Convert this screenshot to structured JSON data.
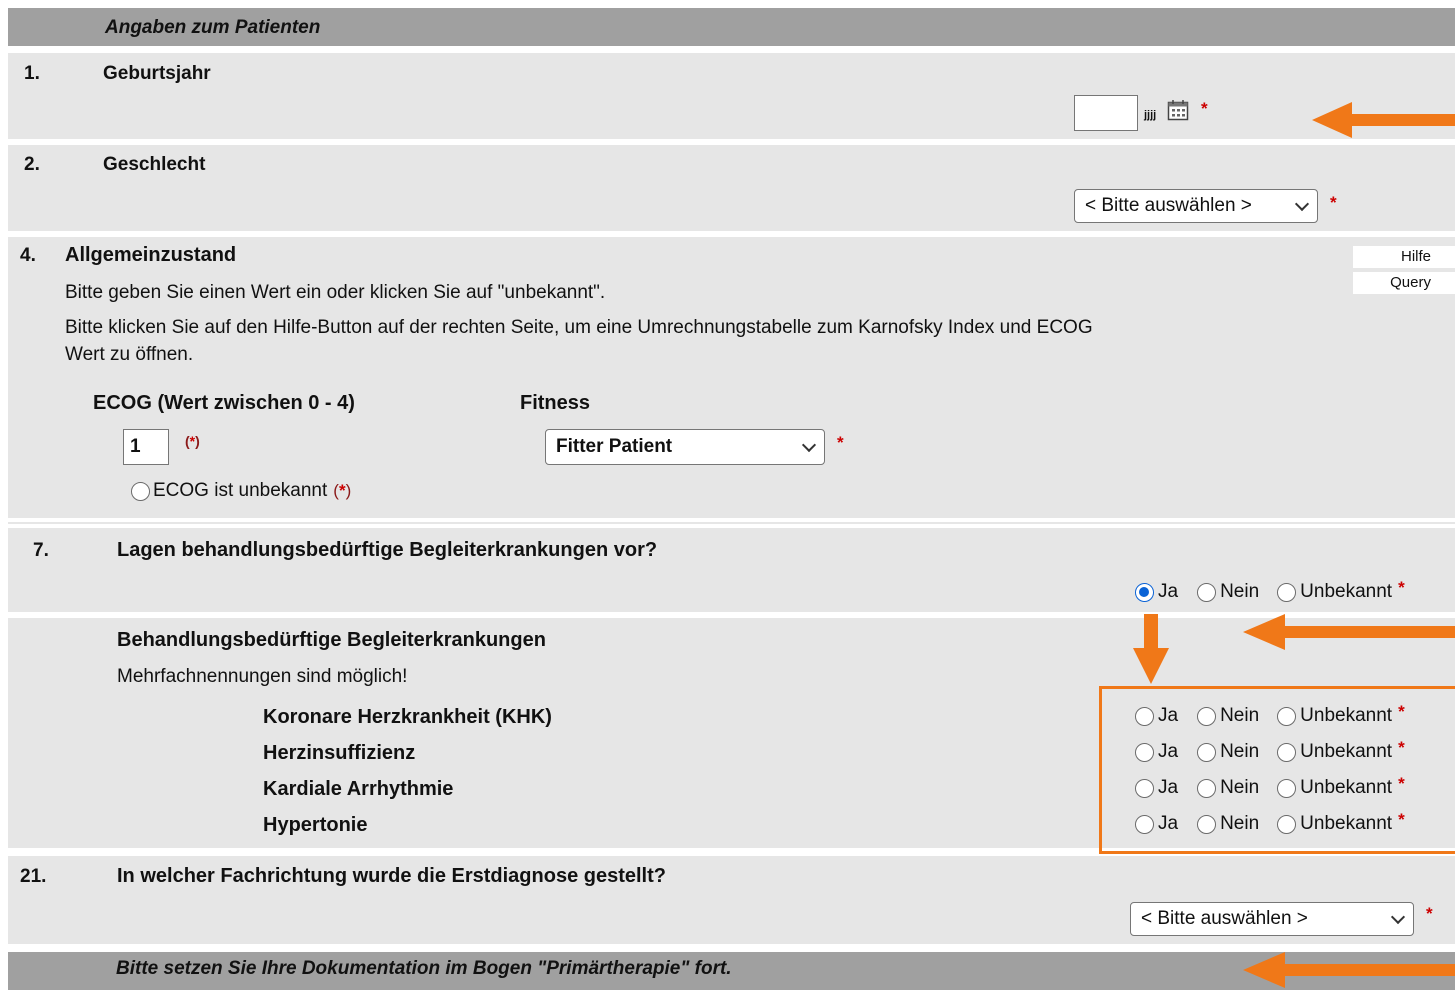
{
  "header": {
    "title": "Angaben zum Patienten"
  },
  "q1": {
    "number": "1.",
    "title": "Geburtsjahr",
    "input_value": "",
    "suffix": "jjjj",
    "required": "*"
  },
  "q2": {
    "number": "2.",
    "title": "Geschlecht",
    "select_value": "< Bitte auswählen >",
    "required": "*"
  },
  "q4": {
    "number": "4.",
    "title": "Allgemeinzustand",
    "help_line1": "Bitte geben Sie einen Wert ein oder klicken Sie auf \"unbekannt\".",
    "help_line2a": "Bitte klicken Sie auf den Hilfe-Button auf der rechten Seite, um eine Umrechnungstabelle zum Karnofsky Index und ECOG",
    "help_line2b": "Wert zu öffnen.",
    "ecog_label": "ECOG (Wert zwischen 0 - 4)",
    "ecog_value": "1",
    "ecog_req_open": "(",
    "ecog_req_star": "*",
    "ecog_req_close": ")",
    "ecog_unknown_label": "ECOG ist unbekannt",
    "fitness_label": "Fitness",
    "fitness_value": "Fitter Patient",
    "fitness_required": "*",
    "help_button": "Hilfe",
    "query_button": "Query"
  },
  "q7": {
    "number": "7.",
    "title": "Lagen behandlungsbedürftige Begleiterkrankungen vor?",
    "options": [
      "Ja",
      "Nein",
      "Unbekannt"
    ],
    "selected": "Ja",
    "required": "*"
  },
  "comorbidities": {
    "title": "Behandlungsbedürftige Begleiterkrankungen",
    "note": "Mehrfachnennungen sind möglich!",
    "items": [
      {
        "label": "Koronare Herzkrankheit (KHK)",
        "options": [
          "Ja",
          "Nein",
          "Unbekannt"
        ],
        "required": "*"
      },
      {
        "label": "Herzinsuffizienz",
        "options": [
          "Ja",
          "Nein",
          "Unbekannt"
        ],
        "required": "*"
      },
      {
        "label": "Kardiale Arrhythmie",
        "options": [
          "Ja",
          "Nein",
          "Unbekannt"
        ],
        "required": "*"
      },
      {
        "label": "Hypertonie",
        "options": [
          "Ja",
          "Nein",
          "Unbekannt"
        ],
        "required": "*"
      }
    ]
  },
  "q21": {
    "number": "21.",
    "title": "In welcher Fachrichtung wurde die Erstdiagnose gestellt?",
    "select_value": "< Bitte auswählen >",
    "required": "*"
  },
  "footer": {
    "text": "Bitte setzen Sie Ihre Dokumentation im Bogen \"Primärtherapie\" fort."
  },
  "colors": {
    "annotation": "#f07818",
    "header_bg": "#a0a0a0",
    "section_bg": "#e6e6e6",
    "required": "#cc0000"
  }
}
